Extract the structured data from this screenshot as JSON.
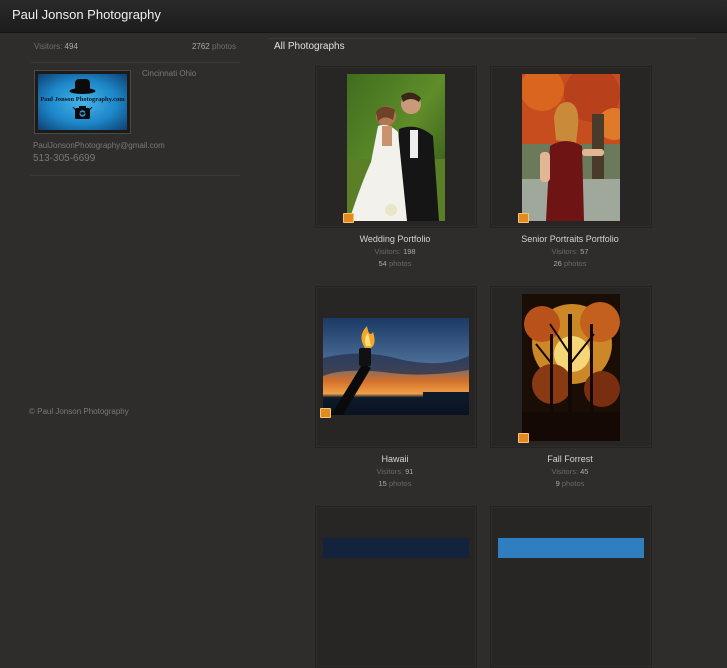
{
  "site": {
    "title": "Paul Jonson Photography"
  },
  "sidebar": {
    "visitors_label": "Visitors:",
    "visitors_value": "494",
    "photos_value": "2762",
    "photos_label": "photos",
    "logo_text": "Paul Jonson Photography.com",
    "city": "Cincinnati Ohio",
    "email": "PaulJonsonPhotography@gmail.com",
    "phone": "513-305-6699",
    "copyright": "© Paul Jonson Photography"
  },
  "main": {
    "title": "All Photographs",
    "albums": [
      {
        "name": "Wedding Portfolio",
        "visitors_label": "Visitors:",
        "visitors": "198",
        "photos": "54",
        "photos_label": "photos"
      },
      {
        "name": "Senior Portraits Portfolio",
        "visitors_label": "Visitors:",
        "visitors": "57",
        "photos": "26",
        "photos_label": "photos"
      },
      {
        "name": "Hawaii",
        "visitors_label": "Visitors:",
        "visitors": "91",
        "photos": "15",
        "photos_label": "photos"
      },
      {
        "name": "Fall Forrest",
        "visitors_label": "Visitors:",
        "visitors": "45",
        "photos": "9",
        "photos_label": "photos"
      }
    ]
  },
  "colors": {
    "background": "#2e2d2b",
    "topbar": "#1f1f1f",
    "album_badge": "#e48a1e",
    "logo_blue": "#1d86c8"
  }
}
